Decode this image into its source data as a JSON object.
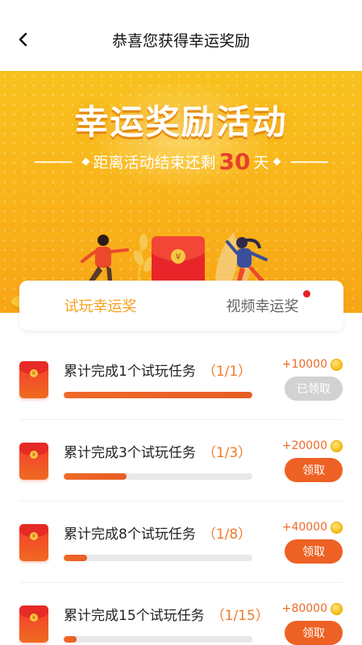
{
  "nav": {
    "title": "恭喜您获得幸运奖励"
  },
  "banner": {
    "headline": "幸运奖励活动",
    "countdown_prefix": "距离活动结束还剩",
    "countdown_days": "30",
    "countdown_suffix": "天",
    "envelope_symbol": "¥"
  },
  "tabs": [
    {
      "label": "试玩幸运奖",
      "active": true
    },
    {
      "label": "视频幸运奖",
      "active": false,
      "has_badge": true
    }
  ],
  "tasks": [
    {
      "label": "累计完成1个试玩任务",
      "progress_text": "（1/1）",
      "progress": 1.0,
      "reward": "+10000",
      "button": "已领取",
      "claimed": true
    },
    {
      "label": "累计完成3个试玩任务",
      "progress_text": "（1/3）",
      "progress": 0.333,
      "reward": "+20000",
      "button": "领取",
      "claimed": false
    },
    {
      "label": "累计完成8个试玩任务",
      "progress_text": "（1/8）",
      "progress": 0.125,
      "reward": "+40000",
      "button": "领取",
      "claimed": false
    },
    {
      "label": "累计完成15个试玩任务",
      "progress_text": "（1/15）",
      "progress": 0.067,
      "reward": "+80000",
      "button": "领取",
      "claimed": false
    }
  ],
  "icons": {
    "back": "chevron-left-icon",
    "coin": "coin-icon",
    "envelope": "red-envelope-icon"
  },
  "colors": {
    "accent": "#f4a21d",
    "primary_button": "#ee6124",
    "banner": "#f9b319",
    "days": "#e8402b"
  }
}
